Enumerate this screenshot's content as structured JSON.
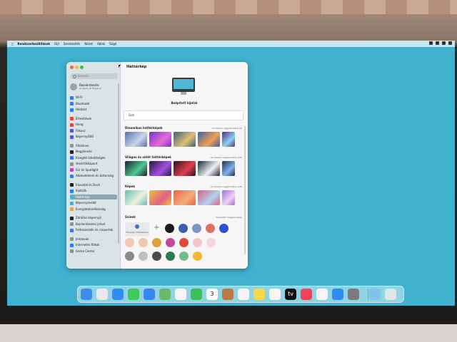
{
  "menubar": {
    "items": [
      "Rendszerbeállítások",
      "Fájl",
      "Szerkesztés",
      "Nézet",
      "Ablak",
      "Súgó"
    ]
  },
  "sidebar": {
    "search_placeholder": "Keresés",
    "profile": {
      "name": "Bejelentkezés",
      "sub": "az Apple ID fiókjával"
    },
    "items": [
      {
        "label": "Wi-Fi",
        "color": "#2f7cf6"
      },
      {
        "label": "Bluetooth",
        "color": "#2f7cf6"
      },
      {
        "label": "Hálózat",
        "color": "#2f7cf6"
      },
      {
        "label": "Értesítések",
        "color": "#e8453c"
      },
      {
        "label": "Hang",
        "color": "#e8453c"
      },
      {
        "label": "Fókusz",
        "color": "#5b4fd6"
      },
      {
        "label": "Képernyőidő",
        "color": "#5b4fd6"
      },
      {
        "label": "Általános",
        "color": "#8e8e93"
      },
      {
        "label": "Megjelenés",
        "color": "#222222"
      },
      {
        "label": "Kisegítő lehetőségek",
        "color": "#2f7cf6"
      },
      {
        "label": "Vezérlőközpont",
        "color": "#8e8e93"
      },
      {
        "label": "Siri és Spotlight",
        "color": "#c03fd1"
      },
      {
        "label": "Adatvédelem és biztonság",
        "color": "#2f7cf6"
      },
      {
        "label": "Íróasztal és Dock",
        "color": "#222222"
      },
      {
        "label": "Kijelzők",
        "color": "#2f7cf6"
      },
      {
        "label": "Háttérkép",
        "color": "#3fb3d8"
      },
      {
        "label": "Képernyővédő",
        "color": "#3fb3d8"
      },
      {
        "label": "Energiatakarékosság",
        "color": "#f2a33a"
      },
      {
        "label": "Zárolási képernyő",
        "color": "#222222"
      },
      {
        "label": "Bejelentkezési jelszó",
        "color": "#8e8e93"
      },
      {
        "label": "Felhasználók és csoportok",
        "color": "#2f7cf6"
      },
      {
        "label": "Jelszavak",
        "color": "#8e8e93"
      },
      {
        "label": "Internetes fiókok",
        "color": "#2f7cf6"
      },
      {
        "label": "Game Center",
        "color": "#8e8e93"
      }
    ],
    "selected_index": 15
  },
  "content": {
    "title": "Háttérkép",
    "monitor_label": "Beépített kijelző",
    "color_row": "Szín",
    "sections": [
      {
        "title": "Dinamikus háttérképek",
        "more": "Az összes megjelenítése (4)",
        "thumbs": [
          "#5a6fb0,#c7d7e8",
          "#7a2fd0,#e86bd8",
          "#3a5f80,#e0c070",
          "#3b5fa8,#f0a050",
          "#4a3080,#8fd0f0"
        ]
      },
      {
        "title": "Világos és sötét háttérképek",
        "more": "Az összes megjelenítése (29)",
        "thumbs": [
          "#1a2030,#50c890",
          "#2a1a40,#a050e0",
          "#301018,#e04050",
          "#182840,#f0f0f0",
          "#203050,#7fb0f0"
        ]
      },
      {
        "title": "Képek",
        "more": "Az összes megjelenítése (18)",
        "thumbs": [
          "#60c0b0,#f0f0e0",
          "#f0c040,#e06080",
          "#f06040,#f0b080",
          "#e06080,#b0d0f0",
          "#a070e0,#f0d0f0"
        ]
      }
    ],
    "colors_title": "Színek",
    "colors_more": "Kevesebb megjelenítése",
    "add_photo_label": "Fénykép hozzáadása",
    "color_swatches_row1": [
      "#1a1a1a",
      "#3b5ea8",
      "#7c93c6",
      "#e06f66",
      "#2d4fd6"
    ],
    "color_swatches_row2": [
      "#f3c7b0",
      "#f0c8a8",
      "#d7a33a",
      "#c24a9c",
      "#e04838",
      "#f5c4c4",
      "#f6d6de"
    ],
    "color_swatches_row3": [
      "#8a8a8a",
      "#c0c0c0",
      "#4a4a4a",
      "#2a7a52",
      "#6cbf8a",
      "#f2b734"
    ]
  },
  "dock": {
    "apps": [
      {
        "name": "Finder",
        "color": "#3b8fe8"
      },
      {
        "name": "Launchpad",
        "color": "#e9e9ee"
      },
      {
        "name": "Safari",
        "color": "#2f8cf0"
      },
      {
        "name": "Messages",
        "color": "#40c85a"
      },
      {
        "name": "Mail",
        "color": "#3a86f0"
      },
      {
        "name": "Maps",
        "color": "#6ab86a"
      },
      {
        "name": "Photos",
        "color": "#f5f5f5"
      },
      {
        "name": "FaceTime",
        "color": "#3cc05a"
      },
      {
        "name": "Calendar",
        "color": "#ffffff",
        "text": "3"
      },
      {
        "name": "Contacts",
        "color": "#b97a4a"
      },
      {
        "name": "Reminders",
        "color": "#f5f5f5"
      },
      {
        "name": "Notes",
        "color": "#f6d84a"
      },
      {
        "name": "Freeform",
        "color": "#f5f5f5"
      },
      {
        "name": "TV",
        "color": "#111111",
        "text": "tv"
      },
      {
        "name": "Music",
        "color": "#f0425a"
      },
      {
        "name": "Screenshot",
        "color": "#f5f5f5"
      },
      {
        "name": "App Store",
        "color": "#2f8cf0"
      },
      {
        "name": "System Settings",
        "color": "#7a7a80"
      },
      {
        "name": "Downloads",
        "color": "#7fc4e8"
      },
      {
        "name": "Trash",
        "color": "#dfe6ea"
      }
    ]
  }
}
